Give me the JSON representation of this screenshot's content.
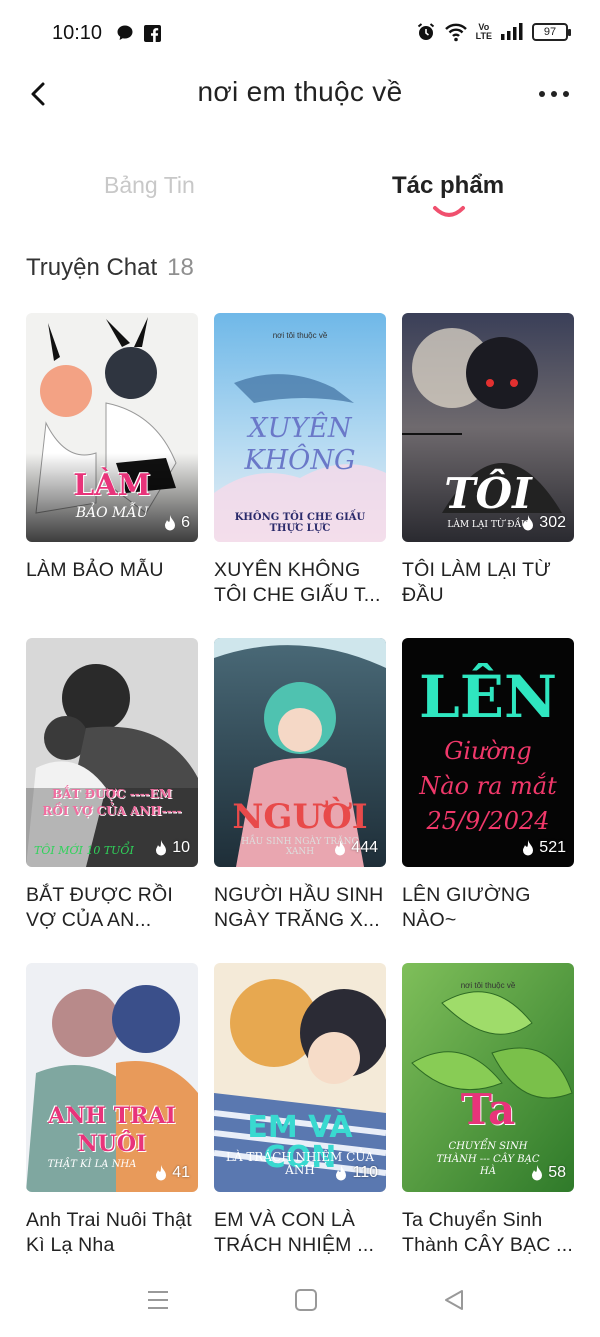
{
  "status_bar": {
    "time": "10:10",
    "left_icons": [
      "chat-bubble-icon",
      "facebook-icon"
    ],
    "right_icons": [
      "alarm-icon",
      "wifi-icon",
      "volte-icon",
      "signal-icon",
      "battery-icon"
    ],
    "volte_line1": "Vo",
    "volte_line2": "LTE",
    "battery": "97"
  },
  "nav": {
    "title": "nơi em thuộc về",
    "back_icon": "chevron-left-icon",
    "more_icon": "more-horizontal-icon"
  },
  "tabs": [
    {
      "label": "Bảng Tin",
      "active": false
    },
    {
      "label": "Tác phẩm",
      "active": true
    }
  ],
  "accent_color": "#f0506e",
  "section": {
    "title": "Truyện Chat",
    "count": "18"
  },
  "stories": [
    {
      "title": "LÀM BẢO MẪU",
      "count": "6",
      "cover_title": "LÀM",
      "cover_sub": "BẢO MẪU",
      "cover_tag": ""
    },
    {
      "title": "XUYÊN KHÔNG TÔI CHE GIẤU T...",
      "count": "",
      "cover_title": "XUYÊN KHÔNG",
      "cover_sub": "KHÔNG TÔI CHE GIẤU THỰC LỰC",
      "cover_tag": "nơi tôi thuộc về"
    },
    {
      "title": "TÔI LÀM LẠI TỪ ĐẦU",
      "count": "302",
      "cover_title": "TÔI",
      "cover_sub": "LÀM LẠI TỪ ĐẦU",
      "cover_tag": ""
    },
    {
      "title": "BẮT ĐƯỢC RỒI VỢ CỦA AN...",
      "count": "10",
      "cover_title": "BẮT ĐƯỢC ----EM RỒI VỢ CỦA ANH----",
      "cover_sub": "TÔI MỚI 10 TUỔI",
      "cover_tag": ""
    },
    {
      "title": "NGƯỜI HẦU SINH NGÀY TRĂNG X...",
      "count": "444",
      "cover_title": "NGƯỜI",
      "cover_sub": "HẦU SINH NGÀY TRĂNG XANH",
      "cover_tag": ""
    },
    {
      "title": "LÊN GIƯỜNG NÀO~",
      "count": "521",
      "cover_title": "LÊN",
      "cover_sub": "Giường Nào ra mắt 25/9/2024",
      "cover_tag": ""
    },
    {
      "title": "Anh Trai Nuôi Thật Kì Lạ Nha",
      "count": "41",
      "cover_title": "ANH TRAI NUÔI",
      "cover_sub": "THẬT KÌ LẠ NHA",
      "cover_tag": ""
    },
    {
      "title": "EM VÀ CON LÀ TRÁCH NHIỆM ...",
      "count": "110",
      "cover_title": "EM VÀ CON",
      "cover_sub": "LÀ TRÁCH NHIỆM CỦA ANH",
      "cover_tag": ""
    },
    {
      "title": "Ta Chuyển Sinh Thành CÂY BẠC ...",
      "count": "58",
      "cover_title": "Ta",
      "cover_sub": "CHUYỂN SINH THÀNH --- CÂY BẠC HÀ",
      "cover_tag": "nơi tôi thuộc về"
    }
  ],
  "system_nav": [
    "menu-lines-icon",
    "home-square-icon",
    "back-triangle-icon"
  ]
}
